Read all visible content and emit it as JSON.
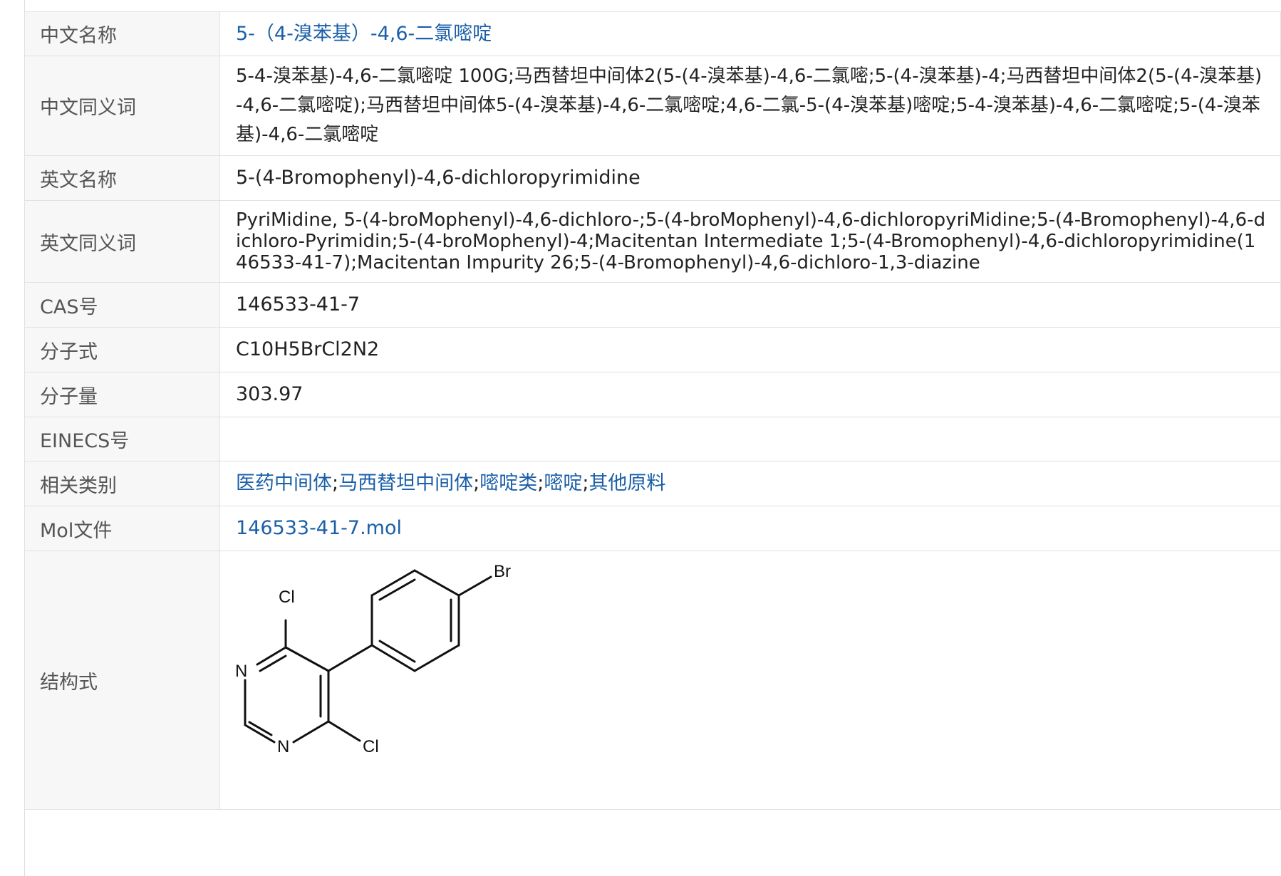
{
  "rows": {
    "cn_name": {
      "label": "中文名称",
      "value": "5-（4-溴苯基）-4,6-二氯嘧啶"
    },
    "cn_synonyms": {
      "label": "中文同义词",
      "value": "5-4-溴苯基)-4,6-二氯嘧啶 100G;马西替坦中间体2(5-(4-溴苯基)-4,6-二氯嘧;5-(4-溴苯基)-4;马西替坦中间体2(5-(4-溴苯基)-4,6-二氯嘧啶);马西替坦中间体5-(4-溴苯基)-4,6-二氯嘧啶;4,6-二氯-5-(4-溴苯基)嘧啶;5-4-溴苯基)-4,6-二氯嘧啶;5-(4-溴苯基)-4,6-二氯嘧啶"
    },
    "en_name": {
      "label": "英文名称",
      "value": "5-(4-Bromophenyl)-4,6-dichloropyrimidine"
    },
    "en_synonyms": {
      "label": "英文同义词",
      "value": "PyriMidine, 5-(4-broMophenyl)-4,6-dichloro-;5-(4-broMophenyl)-4,6-dichloropyriMidine;5-(4-Bromophenyl)-4,6-dichloro-Pyrimidin;5-(4-broMophenyl)-4;Macitentan Intermediate 1;5-(4-Bromophenyl)-4,6-dichloropyrimidine(146533-41-7);Macitentan Impurity 26;5-(4-Bromophenyl)-4,6-dichloro-1,3-diazine"
    },
    "cas": {
      "label": "CAS号",
      "value": "146533-41-7"
    },
    "formula": {
      "label": "分子式",
      "value": "C10H5BrCl2N2"
    },
    "mw": {
      "label": "分子量",
      "value": "303.97"
    },
    "einecs": {
      "label": "EINECS号",
      "value": ""
    },
    "categories": {
      "label": "相关类别",
      "items": [
        "医药中间体",
        "马西替坦中间体",
        "嘧啶类",
        "嘧啶",
        "其他原料"
      ],
      "separator": ";"
    },
    "mol_file": {
      "label": "Mol文件",
      "value": "146533-41-7.mol"
    },
    "structure": {
      "label": "结构式",
      "atoms": {
        "br": "Br",
        "cl_top": "Cl",
        "cl_bottom": "Cl",
        "n_upper": "N",
        "n_lower": "N"
      }
    }
  },
  "colors": {
    "link": "#1a5fa8",
    "label_bg": "#f7f7f7",
    "border": "#e1e1e1"
  }
}
